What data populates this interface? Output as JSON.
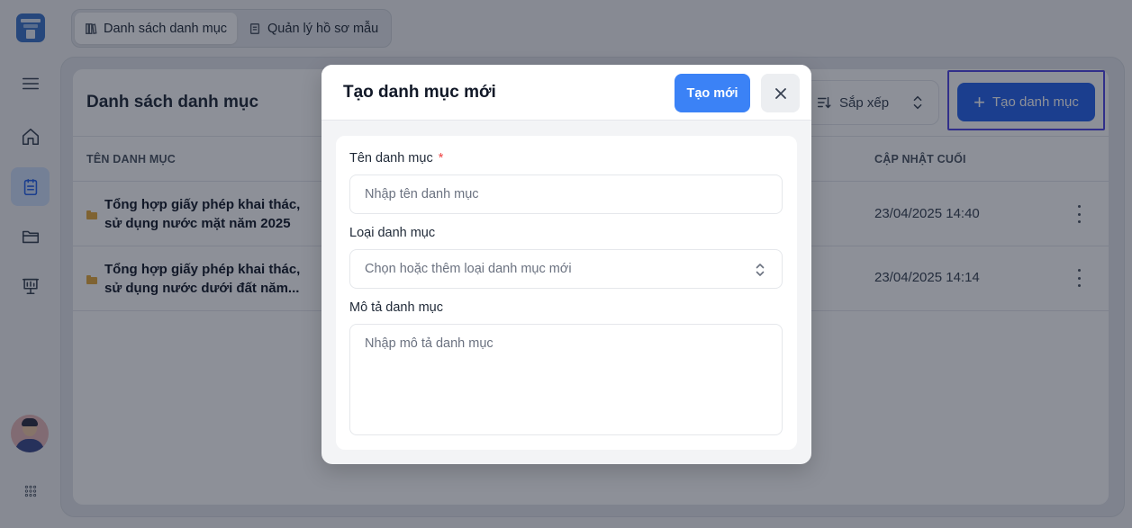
{
  "tabs": [
    {
      "label": "Danh sách danh mục",
      "icon": "library-icon",
      "active": true
    },
    {
      "label": "Quản lý hồ sơ mẫu",
      "icon": "document-icon",
      "active": false
    }
  ],
  "sidebar": {
    "items": [
      {
        "icon": "menu-icon"
      },
      {
        "icon": "home-icon"
      },
      {
        "icon": "clipboard-icon",
        "active": true
      },
      {
        "icon": "folder-icon"
      },
      {
        "icon": "presentation-icon"
      }
    ],
    "bottom": {
      "avatar": "avatar",
      "apps": "grid-dots-icon"
    }
  },
  "main": {
    "title": "Danh sách danh mục",
    "sort_label": "Sắp xếp",
    "create_label": "Tạo danh mục",
    "columns": {
      "name": "TÊN DANH MỤC",
      "updated": "CẬP NHẬT CUỐI"
    },
    "rows": [
      {
        "name": "Tổng hợp giấy phép khai thác, sử dụng nước mặt năm 2025",
        "updated": "23/04/2025 14:40"
      },
      {
        "name": "Tổng hợp giấy phép khai thác, sử dụng nước dưới đất năm...",
        "updated": "23/04/2025 14:14"
      }
    ]
  },
  "modal": {
    "title": "Tạo danh mục mới",
    "submit_label": "Tạo mới",
    "fields": {
      "name": {
        "label": "Tên danh mục",
        "required_mark": "*",
        "placeholder": "Nhập tên danh mục"
      },
      "type": {
        "label": "Loại danh mục",
        "placeholder": "Chọn hoặc thêm loại danh mục mới"
      },
      "description": {
        "label": "Mô tả danh mục",
        "placeholder": "Nhập mô tả danh mục"
      }
    }
  },
  "colors": {
    "primary": "#2563eb",
    "modal_button": "#3b82f6",
    "required": "#ef4444",
    "focus_ring": "#4f46e5"
  }
}
